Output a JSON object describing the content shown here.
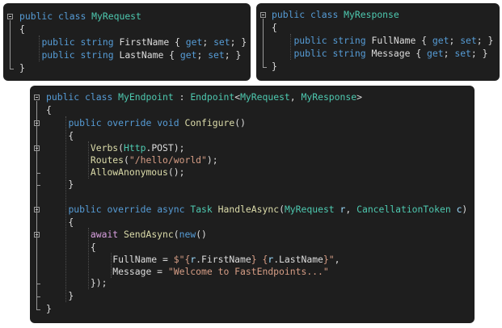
{
  "panels": [
    {
      "id": "my-request",
      "lines": [
        [
          [
            "kw",
            "public"
          ],
          [
            "pun",
            " "
          ],
          [
            "kw",
            "class"
          ],
          [
            "pun",
            " "
          ],
          [
            "cls",
            "MyRequest"
          ]
        ],
        [
          [
            "pun",
            "{"
          ]
        ],
        [
          [
            "pun",
            "    "
          ],
          [
            "kw",
            "public"
          ],
          [
            "pun",
            " "
          ],
          [
            "kw",
            "string"
          ],
          [
            "pun",
            " FirstName { "
          ],
          [
            "kw",
            "get"
          ],
          [
            "pun",
            "; "
          ],
          [
            "kw",
            "set"
          ],
          [
            "pun",
            "; }"
          ]
        ],
        [
          [
            "pun",
            "    "
          ],
          [
            "kw",
            "public"
          ],
          [
            "pun",
            " "
          ],
          [
            "kw",
            "string"
          ],
          [
            "pun",
            " LastName { "
          ],
          [
            "kw",
            "get"
          ],
          [
            "pun",
            "; "
          ],
          [
            "kw",
            "set"
          ],
          [
            "pun",
            "; }"
          ]
        ],
        [
          [
            "pun",
            "}"
          ]
        ]
      ]
    },
    {
      "id": "my-response",
      "lines": [
        [
          [
            "kw",
            "public"
          ],
          [
            "pun",
            " "
          ],
          [
            "kw",
            "class"
          ],
          [
            "pun",
            " "
          ],
          [
            "cls",
            "MyResponse"
          ]
        ],
        [
          [
            "pun",
            "{"
          ]
        ],
        [
          [
            "pun",
            "    "
          ],
          [
            "kw",
            "public"
          ],
          [
            "pun",
            " "
          ],
          [
            "kw",
            "string"
          ],
          [
            "pun",
            " FullName { "
          ],
          [
            "kw",
            "get"
          ],
          [
            "pun",
            "; "
          ],
          [
            "kw",
            "set"
          ],
          [
            "pun",
            "; }"
          ]
        ],
        [
          [
            "pun",
            "    "
          ],
          [
            "kw",
            "public"
          ],
          [
            "pun",
            " "
          ],
          [
            "kw",
            "string"
          ],
          [
            "pun",
            " Message { "
          ],
          [
            "kw",
            "get"
          ],
          [
            "pun",
            "; "
          ],
          [
            "kw",
            "set"
          ],
          [
            "pun",
            "; }"
          ]
        ],
        [
          [
            "pun",
            "}"
          ]
        ]
      ]
    },
    {
      "id": "my-endpoint",
      "lines": [
        [
          [
            "kw",
            "public"
          ],
          [
            "pun",
            " "
          ],
          [
            "kw",
            "class"
          ],
          [
            "pun",
            " "
          ],
          [
            "cls",
            "MyEndpoint"
          ],
          [
            "pun",
            " : "
          ],
          [
            "cls",
            "Endpoint"
          ],
          [
            "pun",
            "<"
          ],
          [
            "cls",
            "MyRequest"
          ],
          [
            "pun",
            ", "
          ],
          [
            "cls",
            "MyResponse"
          ],
          [
            "pun",
            ">"
          ]
        ],
        [
          [
            "pun",
            "{"
          ]
        ],
        [
          [
            "pun",
            "    "
          ],
          [
            "kw",
            "public"
          ],
          [
            "pun",
            " "
          ],
          [
            "kw",
            "override"
          ],
          [
            "pun",
            " "
          ],
          [
            "kw",
            "void"
          ],
          [
            "pun",
            " "
          ],
          [
            "fn",
            "Configure"
          ],
          [
            "pun",
            "()"
          ]
        ],
        [
          [
            "pun",
            "    {"
          ]
        ],
        [
          [
            "pun",
            "        "
          ],
          [
            "fn",
            "Verbs"
          ],
          [
            "pun",
            "("
          ],
          [
            "cls",
            "Http"
          ],
          [
            "pun",
            ".POST);"
          ]
        ],
        [
          [
            "pun",
            "        "
          ],
          [
            "fn",
            "Routes"
          ],
          [
            "pun",
            "("
          ],
          [
            "str",
            "\"/hello/world\""
          ],
          [
            "pun",
            ");"
          ]
        ],
        [
          [
            "pun",
            "        "
          ],
          [
            "fn",
            "AllowAnonymous"
          ],
          [
            "pun",
            "();"
          ]
        ],
        [
          [
            "pun",
            "    }"
          ]
        ],
        [
          [
            "pun",
            ""
          ]
        ],
        [
          [
            "pun",
            "    "
          ],
          [
            "kw",
            "public"
          ],
          [
            "pun",
            " "
          ],
          [
            "kw",
            "override"
          ],
          [
            "pun",
            " "
          ],
          [
            "kw",
            "async"
          ],
          [
            "pun",
            " "
          ],
          [
            "cls",
            "Task"
          ],
          [
            "pun",
            " "
          ],
          [
            "fn",
            "HandleAsync"
          ],
          [
            "pun",
            "("
          ],
          [
            "cls",
            "MyRequest"
          ],
          [
            "pun",
            " "
          ],
          [
            "par",
            "r"
          ],
          [
            "pun",
            ", "
          ],
          [
            "cls",
            "CancellationToken"
          ],
          [
            "pun",
            " "
          ],
          [
            "par",
            "c"
          ],
          [
            "pun",
            ")"
          ]
        ],
        [
          [
            "pun",
            "    {"
          ]
        ],
        [
          [
            "pun",
            "        "
          ],
          [
            "ctl",
            "await"
          ],
          [
            "pun",
            " "
          ],
          [
            "fn",
            "SendAsync"
          ],
          [
            "pun",
            "("
          ],
          [
            "kw",
            "new"
          ],
          [
            "pun",
            "()"
          ]
        ],
        [
          [
            "pun",
            "        {"
          ]
        ],
        [
          [
            "pun",
            "            FullName = "
          ],
          [
            "str",
            "$\"{"
          ],
          [
            "par",
            "r"
          ],
          [
            "pun",
            ".FirstName"
          ],
          [
            "str",
            "} {"
          ],
          [
            "par",
            "r"
          ],
          [
            "pun",
            ".LastName"
          ],
          [
            "str",
            "}\""
          ],
          [
            "pun",
            ","
          ]
        ],
        [
          [
            "pun",
            "            Message = "
          ],
          [
            "str",
            "\"Welcome to FastEndpoints...\""
          ]
        ],
        [
          [
            "pun",
            "        });"
          ]
        ],
        [
          [
            "pun",
            "    }"
          ]
        ],
        [
          [
            "pun",
            "}"
          ]
        ]
      ]
    }
  ],
  "colors": {
    "background": "#1e1e1e",
    "keyword": "#569cd6",
    "type": "#4ec9b0",
    "method": "#dcdcaa",
    "string": "#d69d85",
    "parameter": "#9cdcfe",
    "plain": "#dcdcdc",
    "control": "#d8a0df"
  },
  "icons": [
    "collapse-toggle-icon"
  ]
}
